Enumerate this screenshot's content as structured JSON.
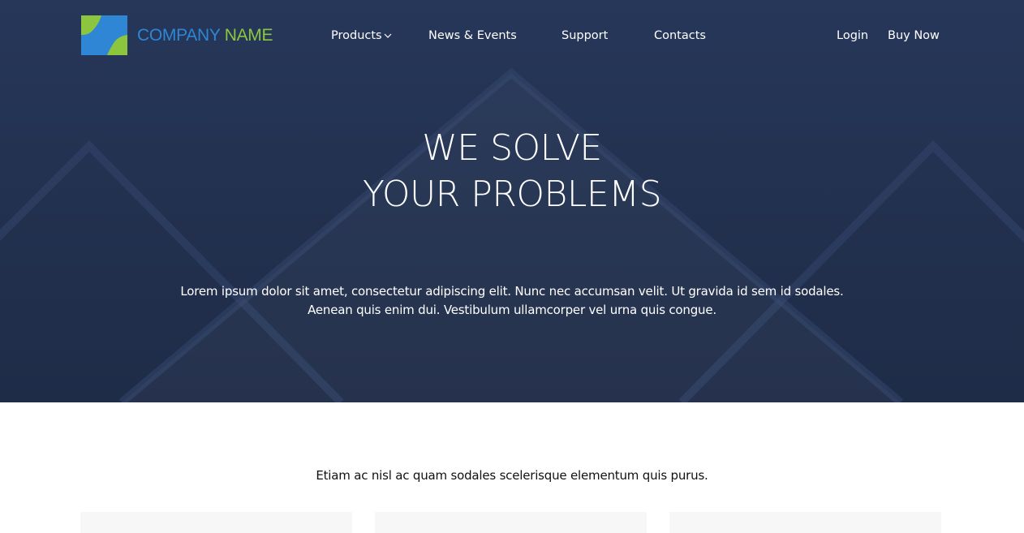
{
  "header": {
    "brand_part1": "COMPANY",
    "brand_part2": "NAME",
    "logo_colors": [
      "#8cc63e",
      "#2f86d4"
    ],
    "nav": {
      "products": "Products",
      "news": "News & Events",
      "support": "Support",
      "contacts": "Contacts"
    },
    "login": "Login",
    "buy_now": "Buy Now"
  },
  "hero": {
    "headline_line1": "WE SOLVE",
    "headline_line2": "YOUR PROBLEMS",
    "text_line1": "Lorem ipsum dolor sit amet, consectetur adipiscing elit. Nunc nec accumsan velit. Ut gravida id sem id sodales.",
    "text_line2": "Aenean quis enim dui. Vestibulum ullamcorper vel urna quis congue."
  },
  "section": {
    "heading": "Etiam ac nisl ac quam sodales scelerisque elementum quis purus."
  },
  "colors": {
    "hero_bg": "#24335a",
    "brand_blue": "#2f86d4",
    "brand_green": "#8cc63e",
    "card_bg": "#f7f7f7"
  }
}
